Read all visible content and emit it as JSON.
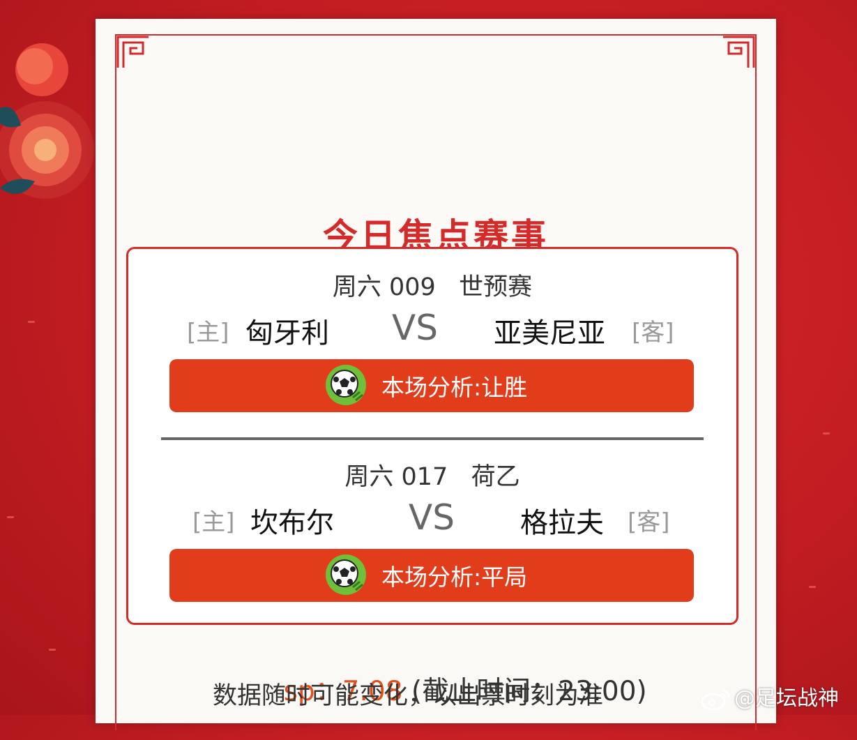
{
  "card": {
    "title": "今日焦点赛事"
  },
  "matches": [
    {
      "header": "周六 009   世预赛",
      "home_tag": "[主]",
      "home_team": "匈牙利",
      "vs": "VS",
      "away_team": "亚美尼亚",
      "away_tag": "[客]",
      "analysis": "本场分析:让胜"
    },
    {
      "header": "周六 017   荷乙",
      "home_tag": "[主]",
      "home_team": "坎布尔",
      "vs": "VS",
      "away_team": "格拉夫",
      "away_tag": "[客]",
      "analysis": "本场分析:平局"
    }
  ],
  "footer": {
    "sp_label": "sp：",
    "sp_value": "7.08",
    "deadline": "(截止时间：23:00)",
    "note": "数据随时可能变化，以出票时刻为准"
  },
  "watermark": {
    "text": "@足坛战神"
  },
  "colors": {
    "background": "#c21d22",
    "accent_red": "#d42a2a",
    "button_orange": "#e23d1b",
    "sp_orange": "#e0501f"
  },
  "icons": [
    "soccer-ball-icon",
    "weibo-icon",
    "fret-corner-ornament",
    "peony-flower"
  ]
}
